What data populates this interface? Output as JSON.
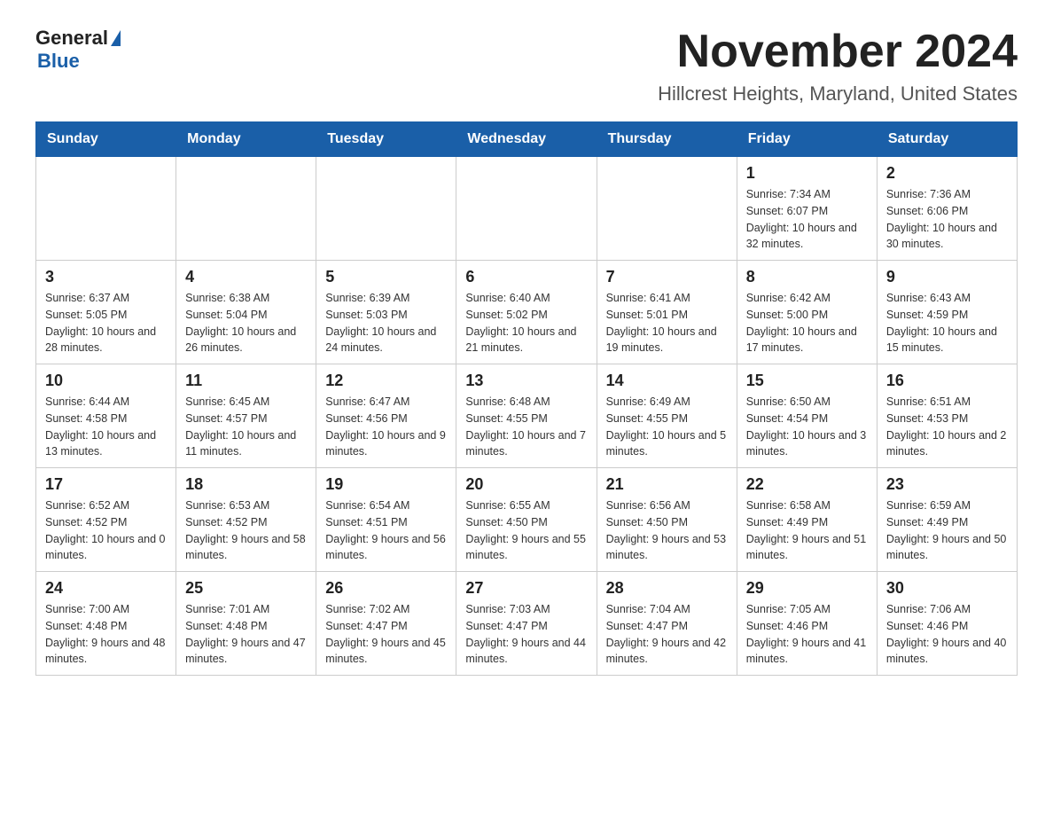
{
  "header": {
    "logo_general": "General",
    "logo_blue": "Blue",
    "title": "November 2024",
    "subtitle": "Hillcrest Heights, Maryland, United States"
  },
  "weekdays": [
    "Sunday",
    "Monday",
    "Tuesday",
    "Wednesday",
    "Thursday",
    "Friday",
    "Saturday"
  ],
  "weeks": [
    [
      {
        "day": "",
        "sunrise": "",
        "sunset": "",
        "daylight": ""
      },
      {
        "day": "",
        "sunrise": "",
        "sunset": "",
        "daylight": ""
      },
      {
        "day": "",
        "sunrise": "",
        "sunset": "",
        "daylight": ""
      },
      {
        "day": "",
        "sunrise": "",
        "sunset": "",
        "daylight": ""
      },
      {
        "day": "",
        "sunrise": "",
        "sunset": "",
        "daylight": ""
      },
      {
        "day": "1",
        "sunrise": "Sunrise: 7:34 AM",
        "sunset": "Sunset: 6:07 PM",
        "daylight": "Daylight: 10 hours and 32 minutes."
      },
      {
        "day": "2",
        "sunrise": "Sunrise: 7:36 AM",
        "sunset": "Sunset: 6:06 PM",
        "daylight": "Daylight: 10 hours and 30 minutes."
      }
    ],
    [
      {
        "day": "3",
        "sunrise": "Sunrise: 6:37 AM",
        "sunset": "Sunset: 5:05 PM",
        "daylight": "Daylight: 10 hours and 28 minutes."
      },
      {
        "day": "4",
        "sunrise": "Sunrise: 6:38 AM",
        "sunset": "Sunset: 5:04 PM",
        "daylight": "Daylight: 10 hours and 26 minutes."
      },
      {
        "day": "5",
        "sunrise": "Sunrise: 6:39 AM",
        "sunset": "Sunset: 5:03 PM",
        "daylight": "Daylight: 10 hours and 24 minutes."
      },
      {
        "day": "6",
        "sunrise": "Sunrise: 6:40 AM",
        "sunset": "Sunset: 5:02 PM",
        "daylight": "Daylight: 10 hours and 21 minutes."
      },
      {
        "day": "7",
        "sunrise": "Sunrise: 6:41 AM",
        "sunset": "Sunset: 5:01 PM",
        "daylight": "Daylight: 10 hours and 19 minutes."
      },
      {
        "day": "8",
        "sunrise": "Sunrise: 6:42 AM",
        "sunset": "Sunset: 5:00 PM",
        "daylight": "Daylight: 10 hours and 17 minutes."
      },
      {
        "day": "9",
        "sunrise": "Sunrise: 6:43 AM",
        "sunset": "Sunset: 4:59 PM",
        "daylight": "Daylight: 10 hours and 15 minutes."
      }
    ],
    [
      {
        "day": "10",
        "sunrise": "Sunrise: 6:44 AM",
        "sunset": "Sunset: 4:58 PM",
        "daylight": "Daylight: 10 hours and 13 minutes."
      },
      {
        "day": "11",
        "sunrise": "Sunrise: 6:45 AM",
        "sunset": "Sunset: 4:57 PM",
        "daylight": "Daylight: 10 hours and 11 minutes."
      },
      {
        "day": "12",
        "sunrise": "Sunrise: 6:47 AM",
        "sunset": "Sunset: 4:56 PM",
        "daylight": "Daylight: 10 hours and 9 minutes."
      },
      {
        "day": "13",
        "sunrise": "Sunrise: 6:48 AM",
        "sunset": "Sunset: 4:55 PM",
        "daylight": "Daylight: 10 hours and 7 minutes."
      },
      {
        "day": "14",
        "sunrise": "Sunrise: 6:49 AM",
        "sunset": "Sunset: 4:55 PM",
        "daylight": "Daylight: 10 hours and 5 minutes."
      },
      {
        "day": "15",
        "sunrise": "Sunrise: 6:50 AM",
        "sunset": "Sunset: 4:54 PM",
        "daylight": "Daylight: 10 hours and 3 minutes."
      },
      {
        "day": "16",
        "sunrise": "Sunrise: 6:51 AM",
        "sunset": "Sunset: 4:53 PM",
        "daylight": "Daylight: 10 hours and 2 minutes."
      }
    ],
    [
      {
        "day": "17",
        "sunrise": "Sunrise: 6:52 AM",
        "sunset": "Sunset: 4:52 PM",
        "daylight": "Daylight: 10 hours and 0 minutes."
      },
      {
        "day": "18",
        "sunrise": "Sunrise: 6:53 AM",
        "sunset": "Sunset: 4:52 PM",
        "daylight": "Daylight: 9 hours and 58 minutes."
      },
      {
        "day": "19",
        "sunrise": "Sunrise: 6:54 AM",
        "sunset": "Sunset: 4:51 PM",
        "daylight": "Daylight: 9 hours and 56 minutes."
      },
      {
        "day": "20",
        "sunrise": "Sunrise: 6:55 AM",
        "sunset": "Sunset: 4:50 PM",
        "daylight": "Daylight: 9 hours and 55 minutes."
      },
      {
        "day": "21",
        "sunrise": "Sunrise: 6:56 AM",
        "sunset": "Sunset: 4:50 PM",
        "daylight": "Daylight: 9 hours and 53 minutes."
      },
      {
        "day": "22",
        "sunrise": "Sunrise: 6:58 AM",
        "sunset": "Sunset: 4:49 PM",
        "daylight": "Daylight: 9 hours and 51 minutes."
      },
      {
        "day": "23",
        "sunrise": "Sunrise: 6:59 AM",
        "sunset": "Sunset: 4:49 PM",
        "daylight": "Daylight: 9 hours and 50 minutes."
      }
    ],
    [
      {
        "day": "24",
        "sunrise": "Sunrise: 7:00 AM",
        "sunset": "Sunset: 4:48 PM",
        "daylight": "Daylight: 9 hours and 48 minutes."
      },
      {
        "day": "25",
        "sunrise": "Sunrise: 7:01 AM",
        "sunset": "Sunset: 4:48 PM",
        "daylight": "Daylight: 9 hours and 47 minutes."
      },
      {
        "day": "26",
        "sunrise": "Sunrise: 7:02 AM",
        "sunset": "Sunset: 4:47 PM",
        "daylight": "Daylight: 9 hours and 45 minutes."
      },
      {
        "day": "27",
        "sunrise": "Sunrise: 7:03 AM",
        "sunset": "Sunset: 4:47 PM",
        "daylight": "Daylight: 9 hours and 44 minutes."
      },
      {
        "day": "28",
        "sunrise": "Sunrise: 7:04 AM",
        "sunset": "Sunset: 4:47 PM",
        "daylight": "Daylight: 9 hours and 42 minutes."
      },
      {
        "day": "29",
        "sunrise": "Sunrise: 7:05 AM",
        "sunset": "Sunset: 4:46 PM",
        "daylight": "Daylight: 9 hours and 41 minutes."
      },
      {
        "day": "30",
        "sunrise": "Sunrise: 7:06 AM",
        "sunset": "Sunset: 4:46 PM",
        "daylight": "Daylight: 9 hours and 40 minutes."
      }
    ]
  ]
}
